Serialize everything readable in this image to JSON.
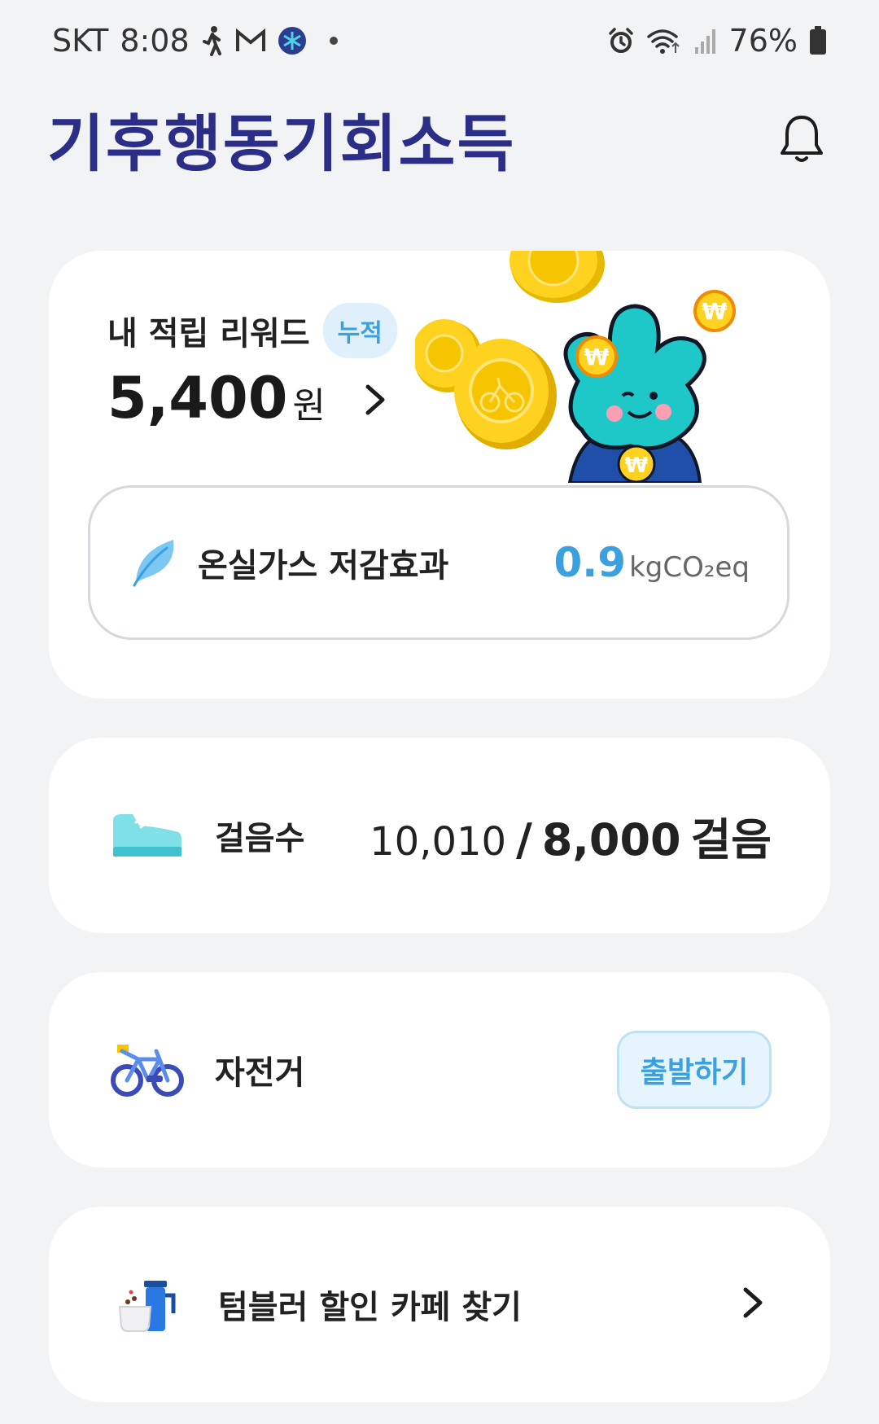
{
  "status_bar": {
    "carrier": "SKT",
    "time": "8:08",
    "battery": "76%"
  },
  "header": {
    "logo_text": "기후행동기회소득",
    "bell_icon": "bell-icon"
  },
  "reward": {
    "title": "내 적립 리워드",
    "badge": "누적",
    "amount": "5,400",
    "unit": "원"
  },
  "ghg": {
    "label": "온실가스 저감효과",
    "value": "0.9",
    "unit": "kgCO₂eq",
    "icon": "leaf-icon"
  },
  "steps": {
    "label": "걸음수",
    "current": "10,010",
    "separator": "/",
    "goal": "8,000",
    "unit": "걸음",
    "icon": "sneaker-icon"
  },
  "bike": {
    "label": "자전거",
    "button": "출발하기",
    "icon": "bicycle-icon"
  },
  "tumbler": {
    "label": "텀블러 할인 카페 찾기",
    "icon": "tumbler-icon"
  },
  "colors": {
    "accent": "#3aa0e0",
    "logo": "#2b2e86",
    "background": "#f2f3f5"
  }
}
